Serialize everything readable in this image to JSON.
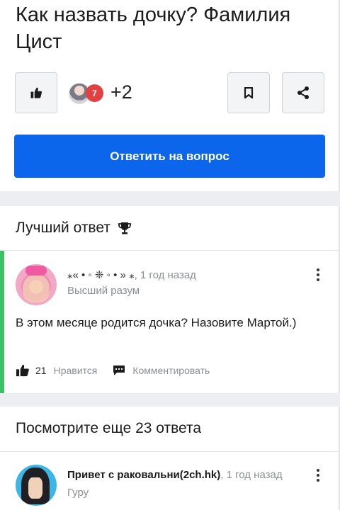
{
  "question": {
    "title": "Как назвать дочку? Фамилия Цист",
    "badge_count": "7",
    "plus_count": "+2",
    "answer_button": "Ответить на вопрос"
  },
  "best_answer": {
    "header": "Лучший ответ",
    "author_name": "⁎« • ◦ ❈ ◦ • » ⁎",
    "time_ago": ", 1 год назад",
    "rank": "Высший разум",
    "text": "В этом месяце родится дочка? Назовите Мартой.)",
    "likes": "21",
    "like_label": "Нравится",
    "comment_label": "Комментировать"
  },
  "more_answers": {
    "title": "Посмотрите еще 23 ответа",
    "first": {
      "author_name": "Привет с раковальни(2ch.hk)",
      "time_ago": ", 1 год назад",
      "rank": "Гуру"
    }
  },
  "colors": {
    "accent": "#0c66ec",
    "best_bar": "#3cc264",
    "badge": "#e34141"
  },
  "icons": [
    "thumbs-up-icon",
    "bookmark-icon",
    "share-icon",
    "trophy-icon",
    "kebab-menu-icon",
    "comment-icon"
  ]
}
